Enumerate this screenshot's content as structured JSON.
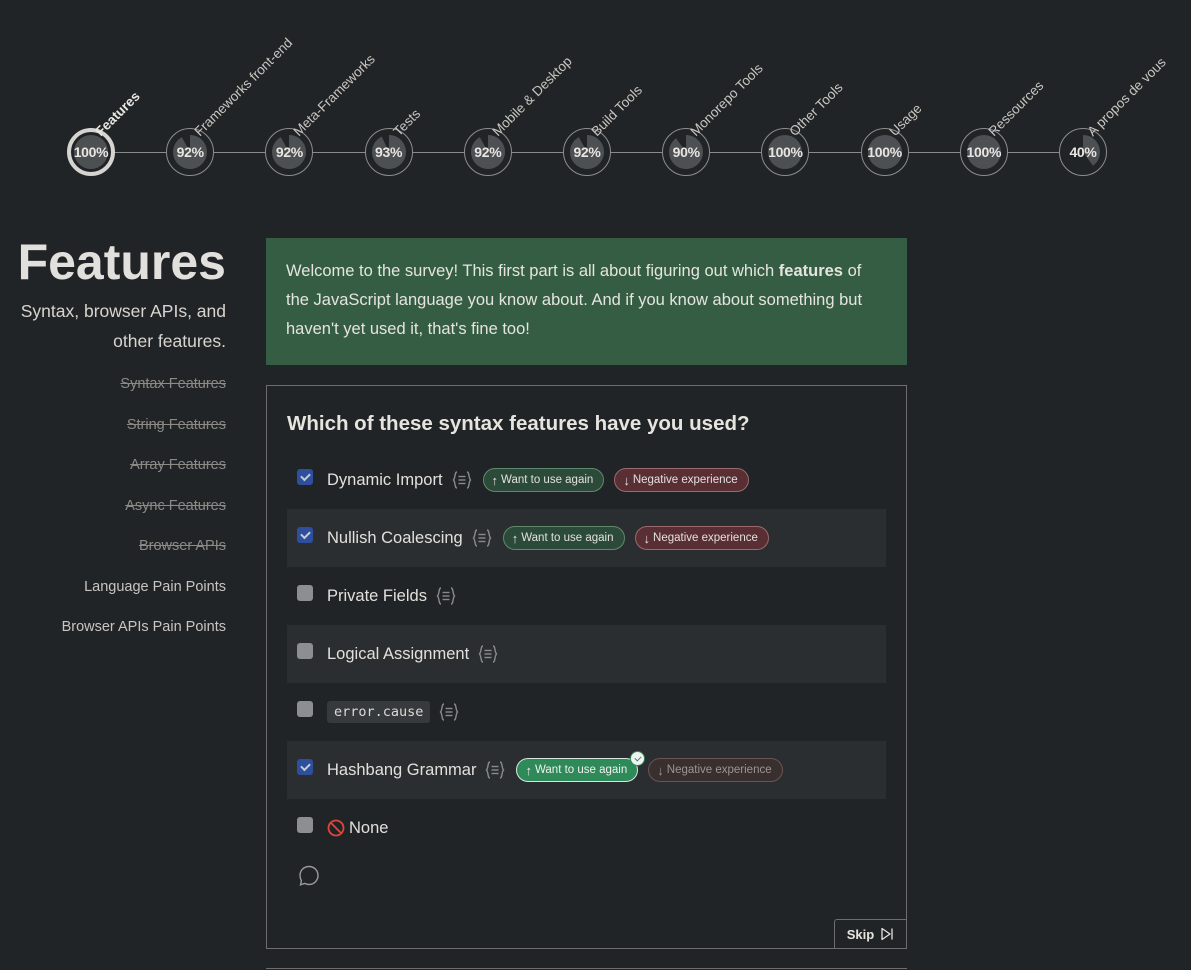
{
  "progress": {
    "steps": [
      {
        "label": "Features",
        "percent": 100,
        "display": "100%",
        "current": true
      },
      {
        "label": "Frameworks front-end",
        "percent": 92,
        "display": "92%",
        "current": false
      },
      {
        "label": "Meta-Frameworks",
        "percent": 92,
        "display": "92%",
        "current": false
      },
      {
        "label": "Tests",
        "percent": 93,
        "display": "93%",
        "current": false
      },
      {
        "label": "Mobile & Desktop",
        "percent": 92,
        "display": "92%",
        "current": false
      },
      {
        "label": "Build Tools",
        "percent": 92,
        "display": "92%",
        "current": false
      },
      {
        "label": "Monorepo Tools",
        "percent": 90,
        "display": "90%",
        "current": false
      },
      {
        "label": "Other Tools",
        "percent": 100,
        "display": "100%",
        "current": false
      },
      {
        "label": "Usage",
        "percent": 100,
        "display": "100%",
        "current": false
      },
      {
        "label": "Ressources",
        "percent": 100,
        "display": "100%",
        "current": false
      },
      {
        "label": "A propos de vous",
        "percent": 40,
        "display": "40%",
        "current": false
      }
    ]
  },
  "sidebar": {
    "title": "Features",
    "subtitle": "Syntax, browser APIs, and other features.",
    "items": [
      {
        "label": "Syntax Features",
        "done": true
      },
      {
        "label": "String Features",
        "done": true
      },
      {
        "label": "Array Features",
        "done": true
      },
      {
        "label": "Async Features",
        "done": true
      },
      {
        "label": "Browser APIs",
        "done": true
      },
      {
        "label": "Language Pain Points",
        "done": false
      },
      {
        "label": "Browser APIs Pain Points",
        "done": false
      }
    ]
  },
  "intro": {
    "before": "Welcome to the survey! This first part is all about figuring out which ",
    "bold": "features",
    "after": " of the JavaScript language you know about. And if you know about something but haven't yet used it, that's fine too!"
  },
  "question": {
    "title": "Which of these syntax features have you used?",
    "positive_label": "Want to use again",
    "negative_label": "Negative experience",
    "positive_arrow": "↑",
    "negative_arrow": "↓",
    "options": [
      {
        "label": "Dynamic Import",
        "code": false,
        "checked": true,
        "sentiment": "none"
      },
      {
        "label": "Nullish Coalescing",
        "code": false,
        "checked": true,
        "sentiment": "none"
      },
      {
        "label": "Private Fields",
        "code": false,
        "checked": false,
        "sentiment": "none"
      },
      {
        "label": "Logical Assignment",
        "code": false,
        "checked": false,
        "sentiment": "none"
      },
      {
        "label": "error.cause",
        "code": true,
        "checked": false,
        "sentiment": "none"
      },
      {
        "label": "Hashbang Grammar",
        "code": false,
        "checked": true,
        "sentiment": "positive"
      }
    ],
    "none_option": {
      "label": "None",
      "checked": false,
      "icon": "prohibited-icon"
    },
    "comment_icon": "comment-icon",
    "skip_label": "Skip"
  },
  "colors": {
    "background": "#212426",
    "intro_bg": "#355d43",
    "checkbox_checked": "#2e4f9e",
    "positive": "#2e8a58",
    "negative": "#5a2f34"
  }
}
